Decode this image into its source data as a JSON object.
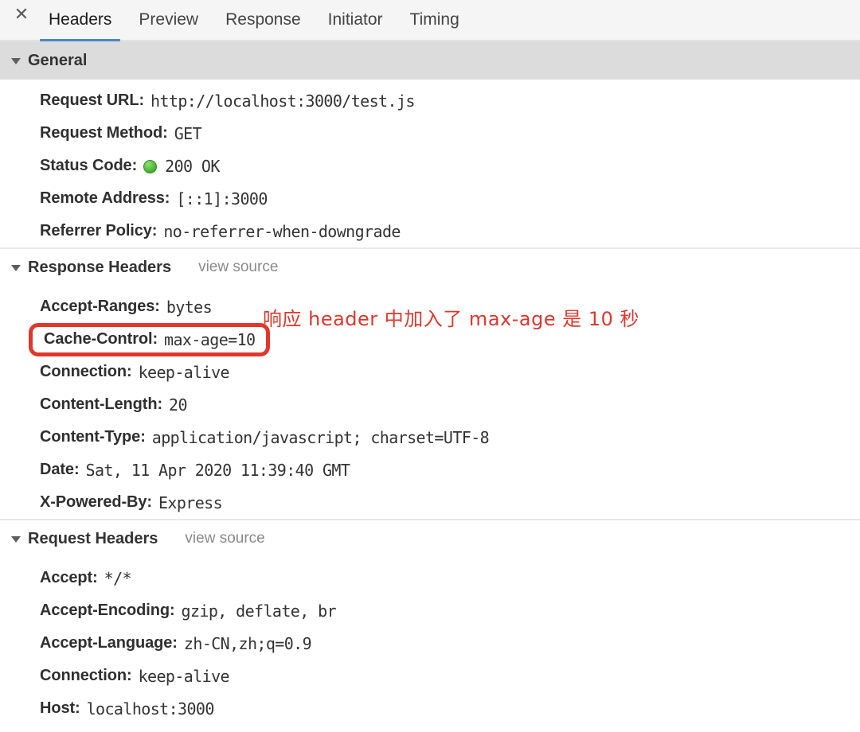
{
  "colors": {
    "accent": "#4b87c7",
    "highlight": "#e0362c",
    "status_ok": "#57bf3f",
    "section_band": "#dcdcdc",
    "tabbar_bg": "#f5f5f5"
  },
  "tabbar": {
    "close_label": "✕",
    "tabs": [
      {
        "label": "Headers",
        "active": true
      },
      {
        "label": "Preview",
        "active": false
      },
      {
        "label": "Response",
        "active": false
      },
      {
        "label": "Initiator",
        "active": false
      },
      {
        "label": "Timing",
        "active": false
      }
    ]
  },
  "sections": [
    {
      "id": "general",
      "title": "General",
      "shaded": true,
      "view_source": null,
      "rows": [
        {
          "key": "Request URL:",
          "value": "http://localhost:3000/test.js"
        },
        {
          "key": "Request Method:",
          "value": "GET"
        },
        {
          "key": "Status Code:",
          "value": "200 OK",
          "status_dot": true
        },
        {
          "key": "Remote Address:",
          "value": "[::1]:3000"
        },
        {
          "key": "Referrer Policy:",
          "value": "no-referrer-when-downgrade"
        }
      ]
    },
    {
      "id": "response-headers",
      "title": "Response Headers",
      "shaded": false,
      "view_source": "view source",
      "rows": [
        {
          "key": "Accept-Ranges:",
          "value": "bytes"
        },
        {
          "key": "Cache-Control:",
          "value": "max-age=10",
          "highlighted": true
        },
        {
          "key": "Connection:",
          "value": "keep-alive"
        },
        {
          "key": "Content-Length:",
          "value": "20"
        },
        {
          "key": "Content-Type:",
          "value": "application/javascript; charset=UTF-8"
        },
        {
          "key": "Date:",
          "value": "Sat, 11 Apr 2020 11:39:40 GMT"
        },
        {
          "key": "X-Powered-By:",
          "value": "Express"
        }
      ]
    },
    {
      "id": "request-headers",
      "title": "Request Headers",
      "shaded": false,
      "view_source": "view source",
      "rows": [
        {
          "key": "Accept:",
          "value": "*/*"
        },
        {
          "key": "Accept-Encoding:",
          "value": "gzip, deflate, br"
        },
        {
          "key": "Accept-Language:",
          "value": "zh-CN,zh;q=0.9"
        },
        {
          "key": "Connection:",
          "value": "keep-alive"
        },
        {
          "key": "Host:",
          "value": "localhost:3000",
          "clipped": true
        }
      ]
    }
  ],
  "annotation": {
    "text": "响应 header 中加入了 max-age 是 10 秒"
  }
}
